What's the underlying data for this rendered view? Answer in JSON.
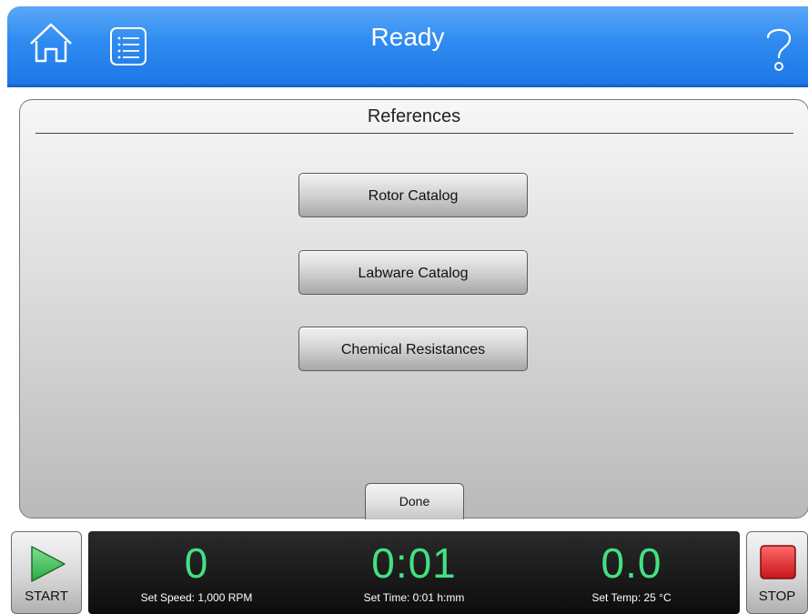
{
  "header": {
    "title": "Ready",
    "home_icon": "home-icon",
    "menu_icon": "list-menu-icon",
    "help_icon": "help-question-icon"
  },
  "panel": {
    "title": "References",
    "buttons": [
      {
        "label": "Rotor Catalog"
      },
      {
        "label": "Labware Catalog"
      },
      {
        "label": "Chemical Resistances"
      }
    ],
    "done_label": "Done"
  },
  "controls": {
    "start_label": "START",
    "stop_label": "STOP"
  },
  "status": {
    "speed": {
      "value": "0",
      "set_label": "Set Speed: 1,000 RPM"
    },
    "time": {
      "value": "0:01",
      "set_label": "Set Time: 0:01 h:mm"
    },
    "temp": {
      "value": "0.0",
      "set_label": "Set Temp: 25 °C"
    }
  },
  "colors": {
    "header_blue": "#2f8bf0",
    "readout_green": "#43e083",
    "stop_red": "#e0262b",
    "start_green": "#3cc45a"
  }
}
